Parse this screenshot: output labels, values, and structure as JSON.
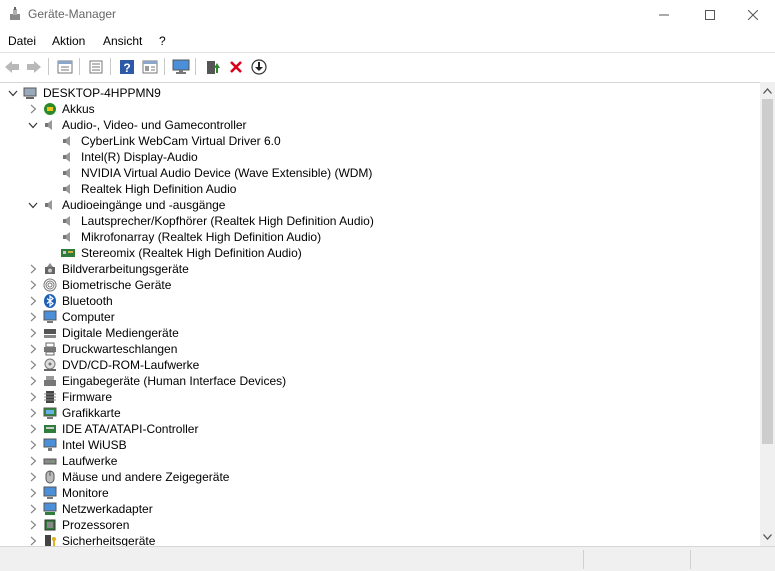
{
  "window": {
    "title": "Geräte-Manager",
    "min_icon": "minimize-icon",
    "max_icon": "maximize-icon",
    "close_icon": "close-icon"
  },
  "menu": {
    "items": [
      "Datei",
      "Aktion",
      "Ansicht",
      "?"
    ]
  },
  "toolbar": {
    "buttons": [
      "back-icon",
      "forward-icon",
      "properties-view-icon",
      "list-view-icon",
      "help-icon",
      "grid-view-icon",
      "monitor-scan-icon",
      "update-driver-icon",
      "uninstall-icon",
      "download-icon"
    ]
  },
  "tree": {
    "root": "DESKTOP-4HPPMN9",
    "rows": [
      {
        "label": "DESKTOP-4HPPMN9",
        "level": 0,
        "state": "expanded",
        "icon": "computer-root-icon"
      },
      {
        "label": "Akkus",
        "level": 1,
        "state": "collapsed",
        "icon": "battery-icon"
      },
      {
        "label": "Audio-, Video- und Gamecontroller",
        "level": 1,
        "state": "expanded",
        "icon": "speaker-icon"
      },
      {
        "label": "CyberLink WebCam Virtual Driver 6.0",
        "level": 2,
        "state": "leaf",
        "icon": "speaker-icon"
      },
      {
        "label": "Intel(R) Display-Audio",
        "level": 2,
        "state": "leaf",
        "icon": "speaker-icon"
      },
      {
        "label": "NVIDIA Virtual Audio Device (Wave Extensible) (WDM)",
        "level": 2,
        "state": "leaf",
        "icon": "speaker-icon"
      },
      {
        "label": "Realtek High Definition Audio",
        "level": 2,
        "state": "leaf",
        "icon": "speaker-icon"
      },
      {
        "label": "Audioeingänge und -ausgänge",
        "level": 1,
        "state": "expanded",
        "icon": "speaker-icon"
      },
      {
        "label": "Lautsprecher/Kopfhörer (Realtek High Definition Audio)",
        "level": 2,
        "state": "leaf",
        "icon": "speaker-icon"
      },
      {
        "label": "Mikrofonarray (Realtek High Definition Audio)",
        "level": 2,
        "state": "leaf",
        "icon": "speaker-icon"
      },
      {
        "label": "Stereomix (Realtek High Definition Audio)",
        "level": 2,
        "state": "leaf",
        "icon": "sound-card-icon"
      },
      {
        "label": "Bildverarbeitungsgeräte",
        "level": 1,
        "state": "collapsed",
        "icon": "camera-icon"
      },
      {
        "label": "Biometrische Geräte",
        "level": 1,
        "state": "collapsed",
        "icon": "fingerprint-icon"
      },
      {
        "label": "Bluetooth",
        "level": 1,
        "state": "collapsed",
        "icon": "bluetooth-icon"
      },
      {
        "label": "Computer",
        "level": 1,
        "state": "collapsed",
        "icon": "monitor-icon"
      },
      {
        "label": "Digitale Mediengeräte",
        "level": 1,
        "state": "collapsed",
        "icon": "media-device-icon"
      },
      {
        "label": "Druckwarteschlangen",
        "level": 1,
        "state": "collapsed",
        "icon": "printer-icon"
      },
      {
        "label": "DVD/CD-ROM-Laufwerke",
        "level": 1,
        "state": "collapsed",
        "icon": "disc-drive-icon"
      },
      {
        "label": "Eingabegeräte (Human Interface Devices)",
        "level": 1,
        "state": "collapsed",
        "icon": "hid-icon"
      },
      {
        "label": "Firmware",
        "level": 1,
        "state": "collapsed",
        "icon": "firmware-icon"
      },
      {
        "label": "Grafikkarte",
        "level": 1,
        "state": "collapsed",
        "icon": "display-adapter-icon"
      },
      {
        "label": "IDE ATA/ATAPI-Controller",
        "level": 1,
        "state": "collapsed",
        "icon": "ide-controller-icon"
      },
      {
        "label": "Intel WiUSB",
        "level": 1,
        "state": "collapsed",
        "icon": "network-monitor-icon"
      },
      {
        "label": "Laufwerke",
        "level": 1,
        "state": "collapsed",
        "icon": "disk-drive-icon"
      },
      {
        "label": "Mäuse und andere Zeigegeräte",
        "level": 1,
        "state": "collapsed",
        "icon": "mouse-icon"
      },
      {
        "label": "Monitore",
        "level": 1,
        "state": "collapsed",
        "icon": "monitor-icon"
      },
      {
        "label": "Netzwerkadapter",
        "level": 1,
        "state": "collapsed",
        "icon": "network-adapter-icon"
      },
      {
        "label": "Prozessoren",
        "level": 1,
        "state": "collapsed",
        "icon": "processor-icon"
      },
      {
        "label": "Sicherheitsgeräte",
        "level": 1,
        "state": "collapsed",
        "icon": "security-device-icon"
      }
    ]
  },
  "colors": {
    "accent_blue": "#1e78d7",
    "delete_red": "#d9001b",
    "green": "#2a8a2a"
  }
}
